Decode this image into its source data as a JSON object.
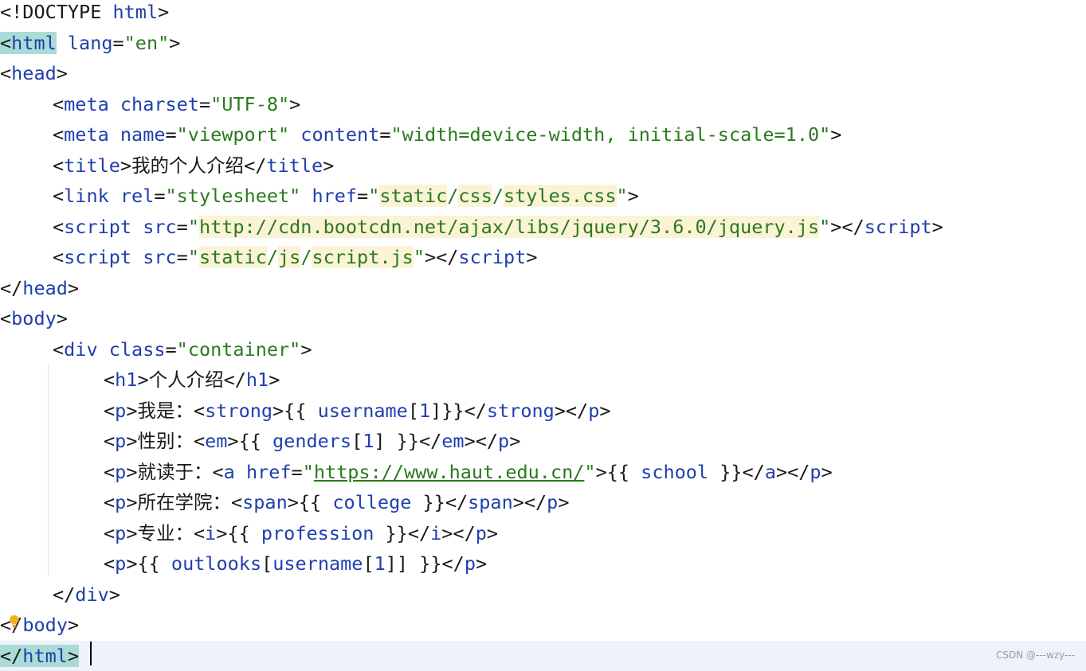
{
  "editor": {
    "lines": [
      {
        "indent": 0,
        "tokens": [
          [
            "p",
            "<"
          ],
          [
            "doc",
            "!DOCTYPE"
          ],
          [
            "p",
            " "
          ],
          [
            "tag",
            "html"
          ],
          [
            "p",
            ">"
          ]
        ]
      },
      {
        "indent": 0,
        "tokens": [
          [
            "p",
            "<",
            "tagmatch"
          ],
          [
            "tag",
            "html",
            "tagmatch"
          ],
          [
            "p",
            " "
          ],
          [
            "attr",
            "lang"
          ],
          [
            "p",
            "="
          ],
          [
            "str",
            "\"en\""
          ],
          [
            "p",
            ">"
          ]
        ]
      },
      {
        "indent": 0,
        "tokens": [
          [
            "p",
            "<"
          ],
          [
            "tag",
            "head"
          ],
          [
            "p",
            ">"
          ]
        ]
      },
      {
        "indent": 1,
        "tokens": [
          [
            "p",
            "<"
          ],
          [
            "tag",
            "meta"
          ],
          [
            "p",
            " "
          ],
          [
            "attr",
            "charset"
          ],
          [
            "p",
            "="
          ],
          [
            "str",
            "\"UTF-8\""
          ],
          [
            "p",
            ">"
          ]
        ]
      },
      {
        "indent": 1,
        "tokens": [
          [
            "p",
            "<"
          ],
          [
            "tag",
            "meta"
          ],
          [
            "p",
            " "
          ],
          [
            "attr",
            "name"
          ],
          [
            "p",
            "="
          ],
          [
            "str",
            "\"viewport\""
          ],
          [
            "p",
            " "
          ],
          [
            "attr",
            "content"
          ],
          [
            "p",
            "="
          ],
          [
            "str",
            "\"width=device-width, initial-scale=1.0\""
          ],
          [
            "p",
            ">"
          ]
        ]
      },
      {
        "indent": 1,
        "tokens": [
          [
            "p",
            "<"
          ],
          [
            "tag",
            "title"
          ],
          [
            "p",
            ">"
          ],
          [
            "txt",
            "我的个人介绍"
          ],
          [
            "p",
            "</"
          ],
          [
            "tag",
            "title"
          ],
          [
            "p",
            ">"
          ]
        ]
      },
      {
        "indent": 1,
        "tokens": [
          [
            "p",
            "<"
          ],
          [
            "tag",
            "link"
          ],
          [
            "p",
            " "
          ],
          [
            "attr",
            "rel"
          ],
          [
            "p",
            "="
          ],
          [
            "str",
            "\"stylesheet\""
          ],
          [
            "p",
            " "
          ],
          [
            "attr",
            "href"
          ],
          [
            "p",
            "="
          ],
          [
            "str",
            "\""
          ],
          [
            "str",
            "static",
            "pathhl"
          ],
          [
            "str",
            "/"
          ],
          [
            "str",
            "css",
            "pathhl"
          ],
          [
            "str",
            "/"
          ],
          [
            "str",
            "styles.css",
            "pathhl"
          ],
          [
            "str",
            "\""
          ],
          [
            "p",
            ">"
          ]
        ]
      },
      {
        "indent": 1,
        "tokens": [
          [
            "p",
            "<"
          ],
          [
            "tag",
            "script"
          ],
          [
            "p",
            " "
          ],
          [
            "attr",
            "src"
          ],
          [
            "p",
            "="
          ],
          [
            "str",
            "\""
          ],
          [
            "str",
            "http://cdn.bootcdn.net/ajax/libs/jquery/3.6.0/jquery.js",
            "pathhl"
          ],
          [
            "str",
            "\""
          ],
          [
            "p",
            "></"
          ],
          [
            "tag",
            "script"
          ],
          [
            "p",
            ">"
          ]
        ]
      },
      {
        "indent": 1,
        "tokens": [
          [
            "p",
            "<"
          ],
          [
            "tag",
            "script"
          ],
          [
            "p",
            " "
          ],
          [
            "attr",
            "src"
          ],
          [
            "p",
            "="
          ],
          [
            "str",
            "\""
          ],
          [
            "str",
            "static",
            "pathhl"
          ],
          [
            "str",
            "/"
          ],
          [
            "str",
            "js",
            "pathhl"
          ],
          [
            "str",
            "/"
          ],
          [
            "str",
            "script.js",
            "pathhl"
          ],
          [
            "str",
            "\""
          ],
          [
            "p",
            "></"
          ],
          [
            "tag",
            "script"
          ],
          [
            "p",
            ">"
          ]
        ]
      },
      {
        "indent": 0,
        "tokens": [
          [
            "p",
            "</"
          ],
          [
            "tag",
            "head"
          ],
          [
            "p",
            ">"
          ]
        ]
      },
      {
        "indent": 0,
        "tokens": [
          [
            "p",
            "<"
          ],
          [
            "tag",
            "body"
          ],
          [
            "p",
            ">"
          ]
        ]
      },
      {
        "indent": 1,
        "tokens": [
          [
            "p",
            "<"
          ],
          [
            "tag",
            "div"
          ],
          [
            "p",
            " "
          ],
          [
            "attr",
            "class"
          ],
          [
            "p",
            "="
          ],
          [
            "str",
            "\"container\""
          ],
          [
            "p",
            ">"
          ]
        ]
      },
      {
        "indent": 2,
        "tokens": [
          [
            "p",
            "<"
          ],
          [
            "tag",
            "h1"
          ],
          [
            "p",
            ">"
          ],
          [
            "txt",
            "个人介绍"
          ],
          [
            "p",
            "</"
          ],
          [
            "tag",
            "h1"
          ],
          [
            "p",
            ">"
          ]
        ]
      },
      {
        "indent": 2,
        "tokens": [
          [
            "p",
            "<"
          ],
          [
            "tag",
            "p"
          ],
          [
            "p",
            ">"
          ],
          [
            "txt",
            "我是："
          ],
          [
            "p",
            "<"
          ],
          [
            "tag",
            "strong"
          ],
          [
            "p",
            ">"
          ],
          [
            "p",
            "{{ "
          ],
          [
            "var",
            "username"
          ],
          [
            "p",
            "["
          ],
          [
            "var",
            "1"
          ],
          [
            "p",
            "]}}"
          ],
          [
            "p",
            "</"
          ],
          [
            "tag",
            "strong"
          ],
          [
            "p",
            "></"
          ],
          [
            "tag",
            "p"
          ],
          [
            "p",
            ">"
          ]
        ]
      },
      {
        "indent": 2,
        "tokens": [
          [
            "p",
            "<"
          ],
          [
            "tag",
            "p"
          ],
          [
            "p",
            ">"
          ],
          [
            "txt",
            "性别："
          ],
          [
            "p",
            "<"
          ],
          [
            "tag",
            "em"
          ],
          [
            "p",
            ">"
          ],
          [
            "p",
            "{{ "
          ],
          [
            "var",
            "genders"
          ],
          [
            "p",
            "["
          ],
          [
            "var",
            "1"
          ],
          [
            "p",
            "] }}"
          ],
          [
            "p",
            "</"
          ],
          [
            "tag",
            "em"
          ],
          [
            "p",
            "></"
          ],
          [
            "tag",
            "p"
          ],
          [
            "p",
            ">"
          ]
        ]
      },
      {
        "indent": 2,
        "tokens": [
          [
            "p",
            "<"
          ],
          [
            "tag",
            "p"
          ],
          [
            "p",
            ">"
          ],
          [
            "txt",
            "就读于："
          ],
          [
            "p",
            "<"
          ],
          [
            "tag",
            "a"
          ],
          [
            "p",
            " "
          ],
          [
            "attr",
            "href"
          ],
          [
            "p",
            "="
          ],
          [
            "str",
            "\""
          ],
          [
            "str",
            "https://www.haut.edu.cn/",
            "uline"
          ],
          [
            "str",
            "\""
          ],
          [
            "p",
            ">"
          ],
          [
            "p",
            "{{ "
          ],
          [
            "var",
            "school"
          ],
          [
            "p",
            " }}"
          ],
          [
            "p",
            "</"
          ],
          [
            "tag",
            "a"
          ],
          [
            "p",
            "></"
          ],
          [
            "tag",
            "p"
          ],
          [
            "p",
            ">"
          ]
        ]
      },
      {
        "indent": 2,
        "tokens": [
          [
            "p",
            "<"
          ],
          [
            "tag",
            "p"
          ],
          [
            "p",
            ">"
          ],
          [
            "txt",
            "所在学院："
          ],
          [
            "p",
            "<"
          ],
          [
            "tag",
            "span"
          ],
          [
            "p",
            ">"
          ],
          [
            "p",
            "{{ "
          ],
          [
            "var",
            "college"
          ],
          [
            "p",
            " }}"
          ],
          [
            "p",
            "</"
          ],
          [
            "tag",
            "span"
          ],
          [
            "p",
            "></"
          ],
          [
            "tag",
            "p"
          ],
          [
            "p",
            ">"
          ]
        ]
      },
      {
        "indent": 2,
        "tokens": [
          [
            "p",
            "<"
          ],
          [
            "tag",
            "p"
          ],
          [
            "p",
            ">"
          ],
          [
            "txt",
            "专业："
          ],
          [
            "p",
            "<"
          ],
          [
            "tag",
            "i"
          ],
          [
            "p",
            ">"
          ],
          [
            "p",
            "{{ "
          ],
          [
            "var",
            "profession"
          ],
          [
            "p",
            " }}"
          ],
          [
            "p",
            "</"
          ],
          [
            "tag",
            "i"
          ],
          [
            "p",
            "></"
          ],
          [
            "tag",
            "p"
          ],
          [
            "p",
            ">"
          ]
        ]
      },
      {
        "indent": 2,
        "tokens": [
          [
            "p",
            "<"
          ],
          [
            "tag",
            "p"
          ],
          [
            "p",
            ">"
          ],
          [
            "p",
            "{{ "
          ],
          [
            "var",
            "outlooks"
          ],
          [
            "p",
            "["
          ],
          [
            "var",
            "username"
          ],
          [
            "p",
            "["
          ],
          [
            "var",
            "1"
          ],
          [
            "p",
            "]] }}"
          ],
          [
            "p",
            "</"
          ],
          [
            "tag",
            "p"
          ],
          [
            "p",
            ">"
          ]
        ]
      },
      {
        "indent": 1,
        "tokens": [
          [
            "p",
            "</"
          ],
          [
            "tag",
            "div"
          ],
          [
            "p",
            ">"
          ]
        ]
      },
      {
        "indent": 0,
        "tokens": [
          [
            "p",
            "<"
          ],
          [
            "p",
            "/"
          ],
          [
            "tag",
            "body"
          ],
          [
            "p",
            ">"
          ]
        ]
      },
      {
        "indent": 0,
        "current": true,
        "tokens": [
          [
            "p",
            "</",
            "tagmatch"
          ],
          [
            "tag",
            "html",
            "tagmatch"
          ],
          [
            "p",
            ">",
            "tagmatch"
          ]
        ]
      }
    ]
  },
  "colors": {
    "tag": "#1f3fae",
    "string": "#2a7a1e",
    "text": "#1a1a1a",
    "path_highlight": "#fbf3d6",
    "tag_match_highlight": "#a9dcd6",
    "current_line": "#eef3fb"
  },
  "icons": {
    "gutter": "lightbulb-icon"
  },
  "watermark": {
    "text": "CSDN @---wzy---"
  }
}
